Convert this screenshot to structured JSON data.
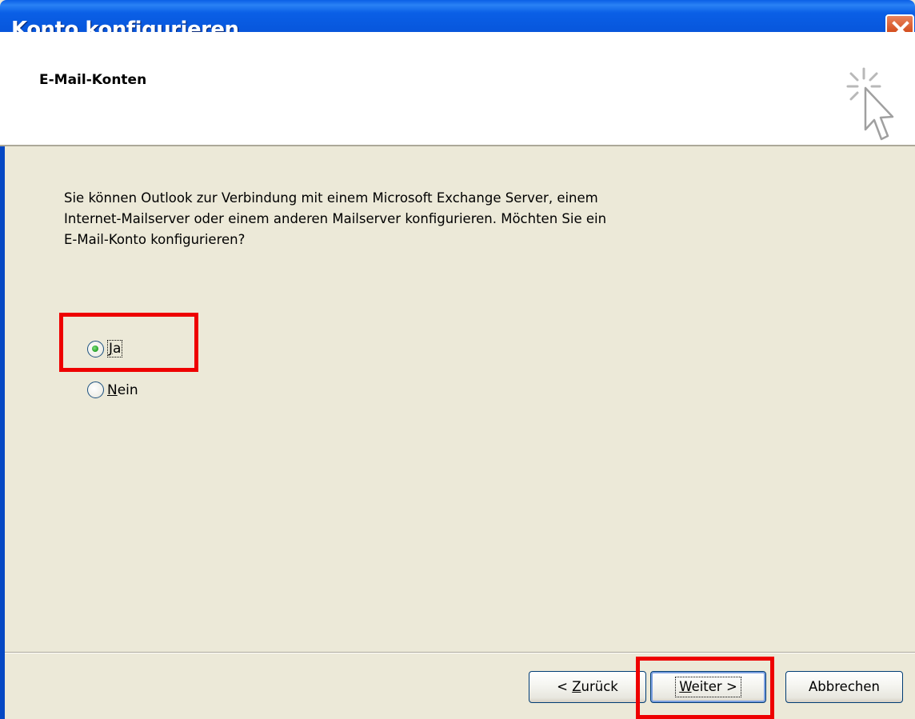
{
  "window": {
    "title": "Konto konfigurieren",
    "close_icon": "close-icon"
  },
  "header": {
    "title": "E-Mail-Konten",
    "icon": "wizard-cursor-sparkle-icon"
  },
  "body": {
    "line1": "Sie können Outlook zur Verbindung mit einem Microsoft Exchange Server, einem",
    "line2": "Internet-Mailserver oder einem anderen Mailserver konfigurieren. Möchten Sie ein",
    "line3": "E-Mail-Konto konfigurieren?"
  },
  "options": {
    "yes": {
      "mnemonic": "J",
      "rest": "a",
      "selected": true
    },
    "no": {
      "mnemonic": "N",
      "rest": "ein",
      "selected": false
    }
  },
  "buttons": {
    "back": {
      "prefix": "< ",
      "mnemonic": "Z",
      "rest": "urück"
    },
    "next": {
      "mnemonic": "W",
      "rest": "eiter >"
    },
    "cancel": {
      "label": "Abbrechen"
    }
  },
  "colors": {
    "titlebar": "#0753d8",
    "dialog_bg": "#ece9d8",
    "highlight": "#ee0000",
    "radio_selected": "#2fa82f"
  }
}
